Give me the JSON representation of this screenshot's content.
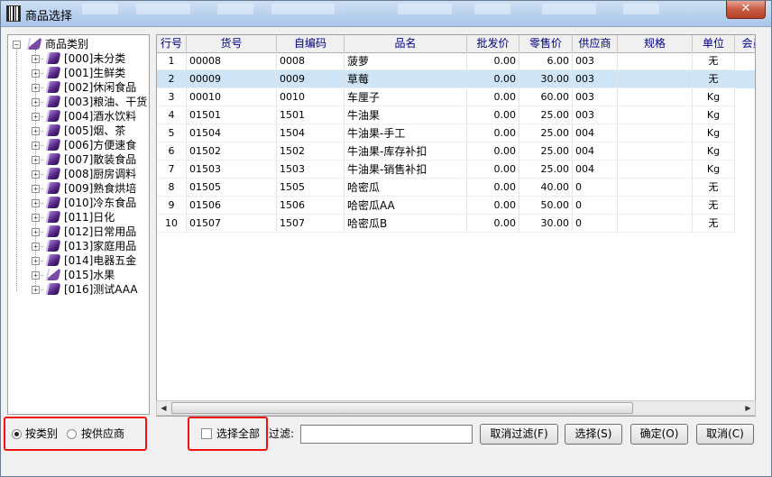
{
  "window": {
    "title": "商品选择",
    "close_glyph": "✕"
  },
  "tree": {
    "root_label": "商品类别",
    "items": [
      {
        "label": "[000]未分类",
        "icon": "book-icon"
      },
      {
        "label": "[001]生鲜类",
        "icon": "book-icon"
      },
      {
        "label": "[002]休闲食品",
        "icon": "book-icon"
      },
      {
        "label": "[003]粮油、干货",
        "icon": "book-icon"
      },
      {
        "label": "[004]酒水饮料",
        "icon": "book-icon"
      },
      {
        "label": "[005]烟、茶",
        "icon": "book-icon"
      },
      {
        "label": "[006]方便速食",
        "icon": "book-icon"
      },
      {
        "label": "[007]散装食品",
        "icon": "book-icon"
      },
      {
        "label": "[008]厨房调料",
        "icon": "book-icon"
      },
      {
        "label": "[009]熟食烘培",
        "icon": "book-icon"
      },
      {
        "label": "[010]冷东食品",
        "icon": "book-icon"
      },
      {
        "label": "[011]日化",
        "icon": "book-icon"
      },
      {
        "label": "[012]日常用品",
        "icon": "book-icon"
      },
      {
        "label": "[013]家庭用品",
        "icon": "book-icon"
      },
      {
        "label": "[014]电器五金",
        "icon": "book-icon"
      },
      {
        "label": "[015]水果",
        "icon": "open-book-icon"
      },
      {
        "label": "[016]测试AAA",
        "icon": "book-icon"
      }
    ]
  },
  "grid": {
    "columns": [
      "行号",
      "货号",
      "自编码",
      "品名",
      "批发价",
      "零售价",
      "供应商",
      "规格",
      "单位",
      "会员"
    ],
    "selected_row": 1,
    "rows": [
      [
        "1",
        "00008",
        "0008",
        "菠萝",
        "0.00",
        "6.00",
        "003",
        "",
        "无"
      ],
      [
        "2",
        "00009",
        "0009",
        "草莓",
        "0.00",
        "30.00",
        "003",
        "",
        "无"
      ],
      [
        "3",
        "00010",
        "0010",
        "车厘子",
        "0.00",
        "60.00",
        "003",
        "",
        "Kg"
      ],
      [
        "4",
        "01501",
        "1501",
        "牛油果",
        "0.00",
        "25.00",
        "003",
        "",
        "Kg"
      ],
      [
        "5",
        "01504",
        "1504",
        "牛油果-手工",
        "0.00",
        "25.00",
        "004",
        "",
        "Kg"
      ],
      [
        "6",
        "01502",
        "1502",
        "牛油果-库存补扣",
        "0.00",
        "25.00",
        "004",
        "",
        "Kg"
      ],
      [
        "7",
        "01503",
        "1503",
        "牛油果-销售补扣",
        "0.00",
        "25.00",
        "004",
        "",
        "Kg"
      ],
      [
        "8",
        "01505",
        "1505",
        "哈密瓜",
        "0.00",
        "40.00",
        "0",
        "",
        "无"
      ],
      [
        "9",
        "01506",
        "1506",
        "哈密瓜AA",
        "0.00",
        "50.00",
        "0",
        "",
        "无"
      ],
      [
        "10",
        "01507",
        "1507",
        "哈密瓜B",
        "0.00",
        "30.00",
        "0",
        "",
        "无"
      ]
    ]
  },
  "bottom": {
    "radio_by_category": "按类别",
    "radio_by_supplier": "按供应商",
    "select_all": "选择全部",
    "filter_label": "过滤:",
    "filter_value": "",
    "btn_cancel_filter": "取消过滤(F)",
    "btn_select": "选择(S)",
    "btn_ok": "确定(O)",
    "btn_cancel": "取消(C)"
  },
  "colors": {
    "highlight_box": "#f31212",
    "selected_row": "#cfe4f5",
    "header_text": "#000080"
  }
}
